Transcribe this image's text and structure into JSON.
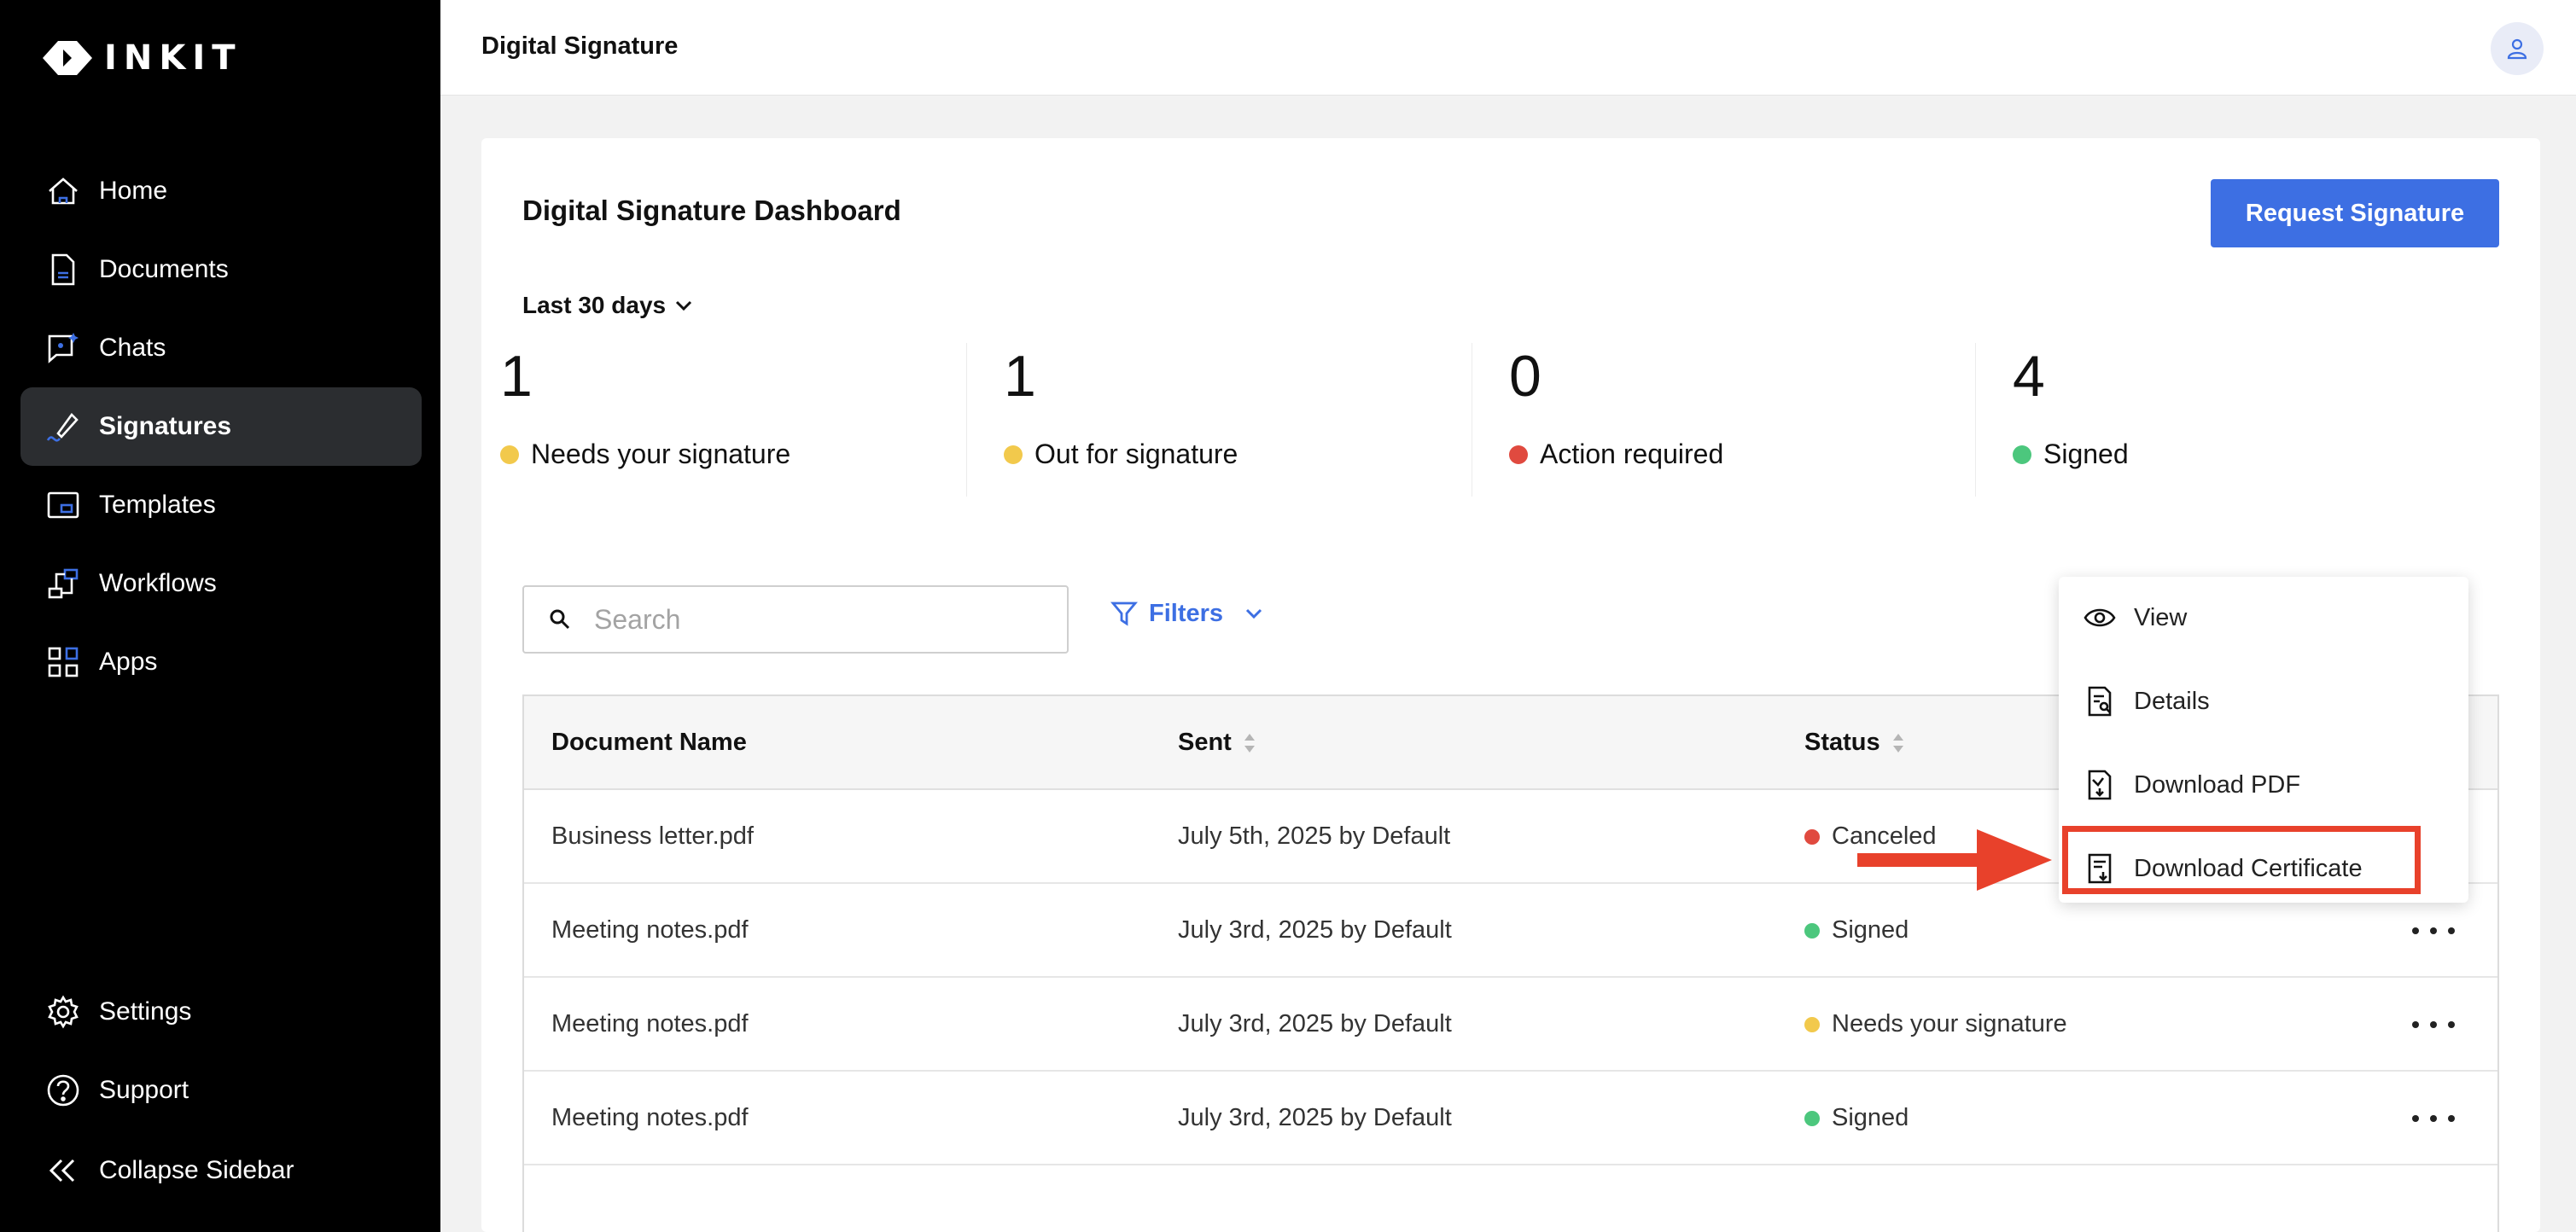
{
  "sidebar": {
    "logo_text": "INKIT",
    "items": [
      {
        "label": "Home",
        "icon": "home-icon"
      },
      {
        "label": "Documents",
        "icon": "document-icon"
      },
      {
        "label": "Chats",
        "icon": "chat-icon"
      },
      {
        "label": "Signatures",
        "icon": "signature-icon",
        "active": true
      },
      {
        "label": "Templates",
        "icon": "template-icon"
      },
      {
        "label": "Workflows",
        "icon": "workflow-icon"
      },
      {
        "label": "Apps",
        "icon": "apps-icon"
      }
    ],
    "bottom": [
      {
        "label": "Settings",
        "icon": "gear-icon"
      },
      {
        "label": "Support",
        "icon": "help-icon"
      },
      {
        "label": "Collapse Sidebar",
        "icon": "collapse-icon"
      }
    ]
  },
  "header": {
    "title": "Digital Signature",
    "avatar_icon": "user-icon"
  },
  "dashboard": {
    "title": "Digital Signature Dashboard",
    "request_button": "Request Signature",
    "range_label": "Last 30 days",
    "stats": [
      {
        "value": "1",
        "label": "Needs your signature",
        "color": "#f2c94c"
      },
      {
        "value": "1",
        "label": "Out for signature",
        "color": "#f2c94c"
      },
      {
        "value": "0",
        "label": "Action required",
        "color": "#e04a3f"
      },
      {
        "value": "4",
        "label": "Signed",
        "color": "#4cc77d"
      }
    ]
  },
  "search": {
    "placeholder": "Search"
  },
  "filters": {
    "label": "Filters"
  },
  "table": {
    "columns": [
      "Document Name",
      "Sent",
      "Status"
    ],
    "rows": [
      {
        "name": "Business letter.pdf",
        "sent": "July 5th, 2025 by Default",
        "status": "Canceled",
        "status_color": "#e04a3f"
      },
      {
        "name": "Meeting notes.pdf",
        "sent": "July 3rd, 2025 by Default",
        "status": "Signed",
        "status_color": "#4cc77d"
      },
      {
        "name": "Meeting notes.pdf",
        "sent": "July 3rd, 2025 by Default",
        "status": "Needs your signature",
        "status_color": "#f2c94c"
      },
      {
        "name": "Meeting notes.pdf",
        "sent": "July 3rd, 2025 by Default",
        "status": "Signed",
        "status_color": "#4cc77d"
      }
    ]
  },
  "menu": {
    "items": [
      {
        "label": "View",
        "icon": "eye-icon"
      },
      {
        "label": "Details",
        "icon": "details-icon"
      },
      {
        "label": "Download PDF",
        "icon": "download-pdf-icon"
      },
      {
        "label": "Download Certificate",
        "icon": "download-certificate-icon"
      }
    ],
    "highlight_color": "#e8412b"
  }
}
